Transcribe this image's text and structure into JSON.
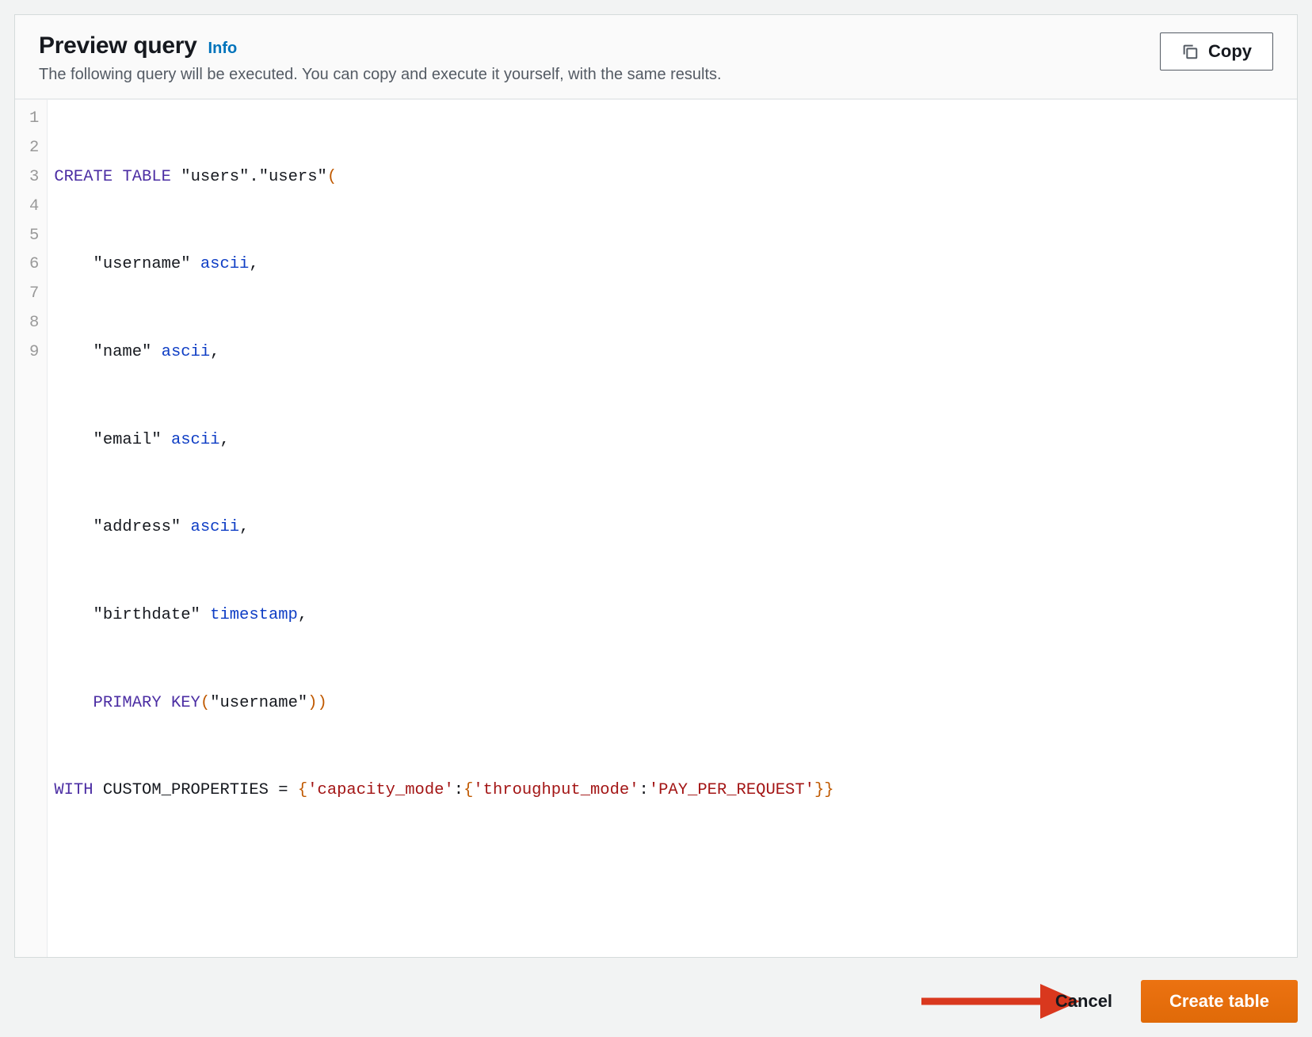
{
  "panel": {
    "title": "Preview query",
    "info_label": "Info",
    "subtitle": "The following query will be executed. You can copy and execute it yourself, with the same results.",
    "copy_label": "Copy"
  },
  "code": {
    "lines": [
      1,
      2,
      3,
      4,
      5,
      6,
      7,
      8,
      9
    ],
    "l1_kw1": "CREATE",
    "l1_kw2": "TABLE",
    "l1_q1": "\"users\"",
    "l1_dot": ".",
    "l1_q2": "\"users\"",
    "l1_paren": "(",
    "l2_col": "    \"username\"",
    "l2_type": " ascii",
    "l2_end": ",",
    "l3_col": "    \"name\"",
    "l3_type": " ascii",
    "l3_end": ",",
    "l4_col": "    \"email\"",
    "l4_type": " ascii",
    "l4_end": ",",
    "l5_col": "    \"address\"",
    "l5_type": " ascii",
    "l5_end": ",",
    "l6_col": "    \"birthdate\"",
    "l6_type": " timestamp",
    "l6_end": ",",
    "l7_pre": "    ",
    "l7_kw1": "PRIMARY",
    "l7_kw2": " KEY",
    "l7_paren1": "(",
    "l7_col": "\"username\"",
    "l7_paren2": "))",
    "l8_kw": "WITH",
    "l8_id": " CUSTOM_PROPERTIES ",
    "l8_eq": "=",
    "l8_sp": " ",
    "l8_b1": "{",
    "l8_s1": "'capacity_mode'",
    "l8_c1": ":",
    "l8_b2": "{",
    "l8_s2": "'throughput_mode'",
    "l8_c2": ":",
    "l8_s3": "'PAY_PER_REQUEST'",
    "l8_b3": "}}"
  },
  "footer": {
    "cancel_label": "Cancel",
    "create_label": "Create table"
  }
}
